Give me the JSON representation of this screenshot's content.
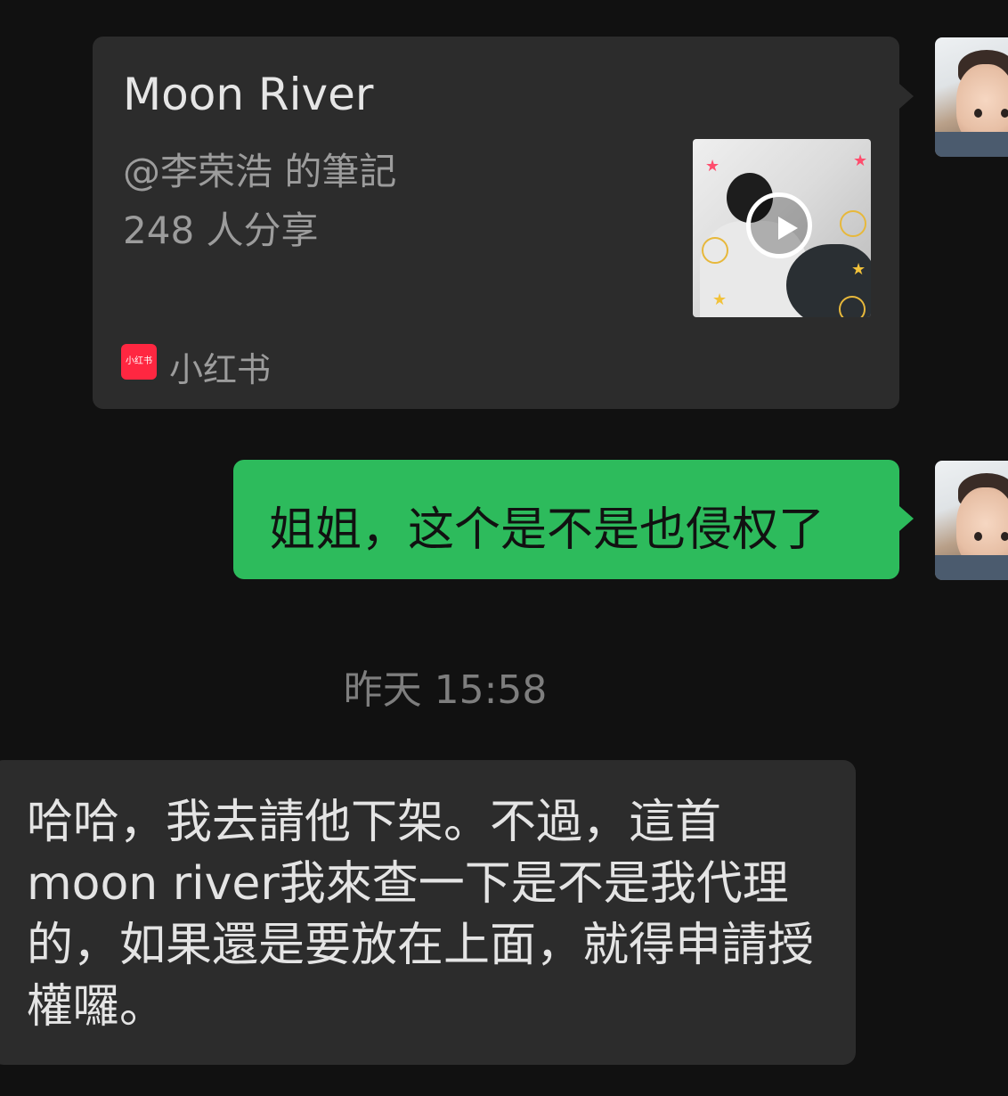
{
  "card": {
    "title": "Moon River",
    "author": "@李荣浩 的筆記",
    "shares": "248 人分享",
    "source_name": "小红书",
    "source_logo_text": "小红书",
    "source_color": "#ff2741",
    "thumbnail_icon": "play-icon"
  },
  "outgoing_message": {
    "text": "姐姐，这个是不是也侵权了",
    "bubble_color": "#2dbb5c"
  },
  "timestamp": "昨天 15:58",
  "incoming_message": {
    "text": "哈哈，我去請他下架。不過，這首moon river我來查一下是不是我代理的，如果還是要放在上面，就得申請授權囉。"
  }
}
